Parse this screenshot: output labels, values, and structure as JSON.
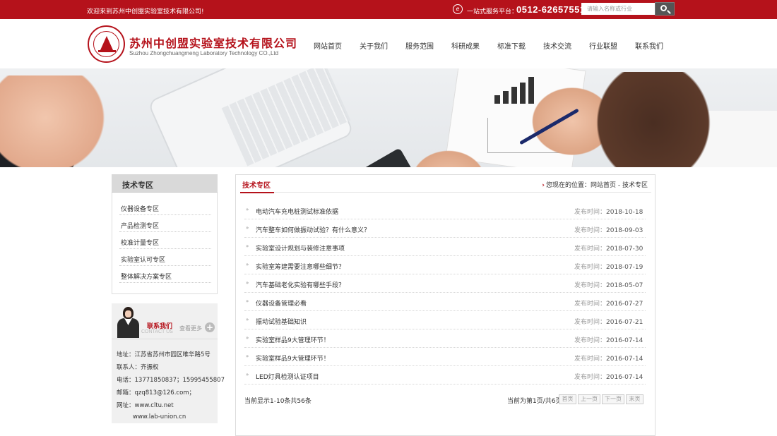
{
  "topbar": {
    "welcome": "欢迎来到苏州中创盟实验室技术有限公司!",
    "hotline_label": "一站式服务平台：",
    "hotline_number": "0512-62657551",
    "search_placeholder": "请输入名称或行业"
  },
  "header": {
    "company_name": "苏州中创盟实验室技术有限公司",
    "company_name_en": "Suzhou Zhongchuangmeng Laboratory Technology CO.,Ltd",
    "nav": [
      "网站首页",
      "关于我们",
      "服务范围",
      "科研成果",
      "标准下载",
      "技术交流",
      "行业联盟",
      "联系我们"
    ]
  },
  "sidebar": {
    "title": "技术专区",
    "items": [
      "仪器设备专区",
      "产品检测专区",
      "校准计量专区",
      "实验室认可专区",
      "整体解决方案专区"
    ]
  },
  "contact": {
    "title": "联系我们",
    "title_en": "CONTACT US",
    "more": "查看更多",
    "lines": [
      "地址：江苏省苏州市园区唯华路5号",
      "联系人：齐振权",
      "电话：13771850837；15995455807",
      "邮箱：qzq813@126.com；",
      "网址：www.cltu.net",
      "www.lab-union.cn"
    ]
  },
  "main": {
    "title": "技术专区",
    "breadcrumb_prefix": "您现在的位置：",
    "breadcrumb": "网站首页 - 技术专区",
    "date_label": "发布时间：",
    "articles": [
      {
        "title": "电动汽车充电桩测试标准依据",
        "date": "2018-10-18"
      },
      {
        "title": "汽车整车如何做振动试验？有什么意义？",
        "date": "2018-09-03"
      },
      {
        "title": "实验室设计规划与装修注意事项",
        "date": "2018-07-30"
      },
      {
        "title": "实验室筹建需要注意哪些细节？",
        "date": "2018-07-19"
      },
      {
        "title": "汽车基础老化实验有哪些手段？",
        "date": "2018-05-07"
      },
      {
        "title": "仪器设备管理必看",
        "date": "2016-07-27"
      },
      {
        "title": "振动试验基础知识",
        "date": "2016-07-21"
      },
      {
        "title": "实验室样品9大管理环节！",
        "date": "2016-07-14"
      },
      {
        "title": "实验室样品9大管理环节！",
        "date": "2016-07-14"
      },
      {
        "title": "LED灯具检测认证项目",
        "date": "2016-07-14"
      }
    ],
    "count_text": "当前显示1-10条共56条",
    "page_info": "当前为第1页/共6页",
    "pager": [
      "首页",
      "上一页",
      "下一页",
      "末页"
    ]
  }
}
